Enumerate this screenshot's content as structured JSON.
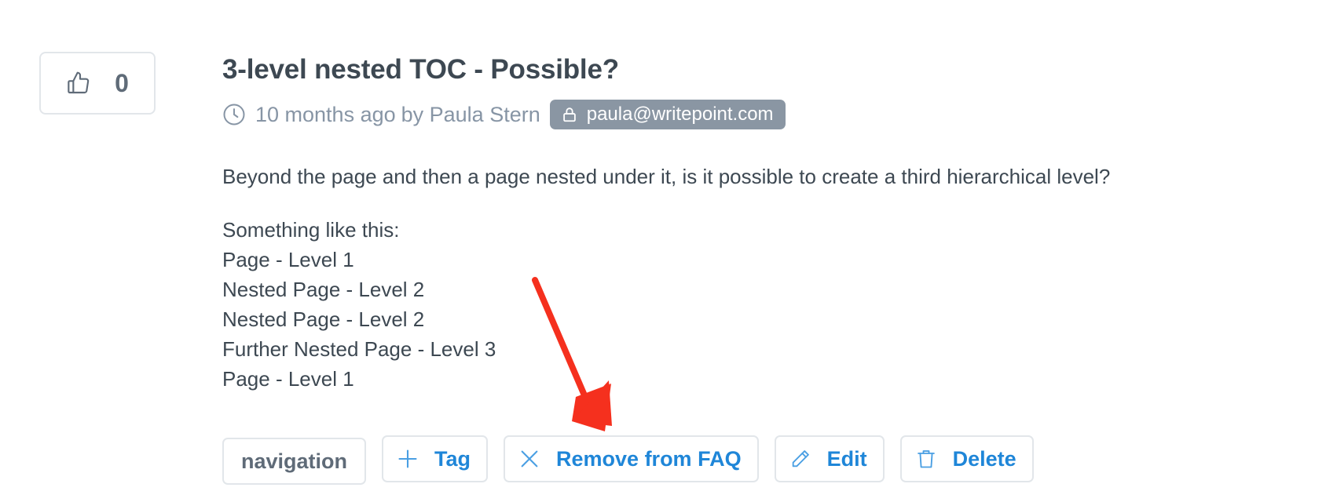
{
  "vote": {
    "icon": "thumbs-up-icon",
    "count": "0"
  },
  "post": {
    "title": "3-level nested TOC - Possible?",
    "meta": {
      "time_icon": "clock-icon",
      "time": "10 months ago",
      "by_text": "by Paula Stern",
      "badge_icon": "lock-icon",
      "email": "paula@writepoint.com"
    },
    "body": {
      "paragraph1": "Beyond the page and then a page nested under it, is it possible to create a third hierarchical level?",
      "lines": [
        "Something like this:",
        "Page - Level 1",
        "Nested Page - Level 2",
        "Nested Page - Level 2",
        "Further Nested Page - Level 3",
        "Page - Level 1"
      ]
    }
  },
  "actions": {
    "tag_chip": "navigation",
    "add_tag": {
      "icon": "plus-icon",
      "label": "Tag"
    },
    "remove_faq": {
      "icon": "close-icon",
      "label": "Remove from FAQ"
    },
    "edit": {
      "icon": "pencil-icon",
      "label": "Edit"
    },
    "delete": {
      "icon": "trash-icon",
      "label": "Delete"
    }
  },
  "colors": {
    "accent": "#1f86d8",
    "badge_bg": "#8a96a3",
    "annotation_arrow": "#f5301e"
  }
}
